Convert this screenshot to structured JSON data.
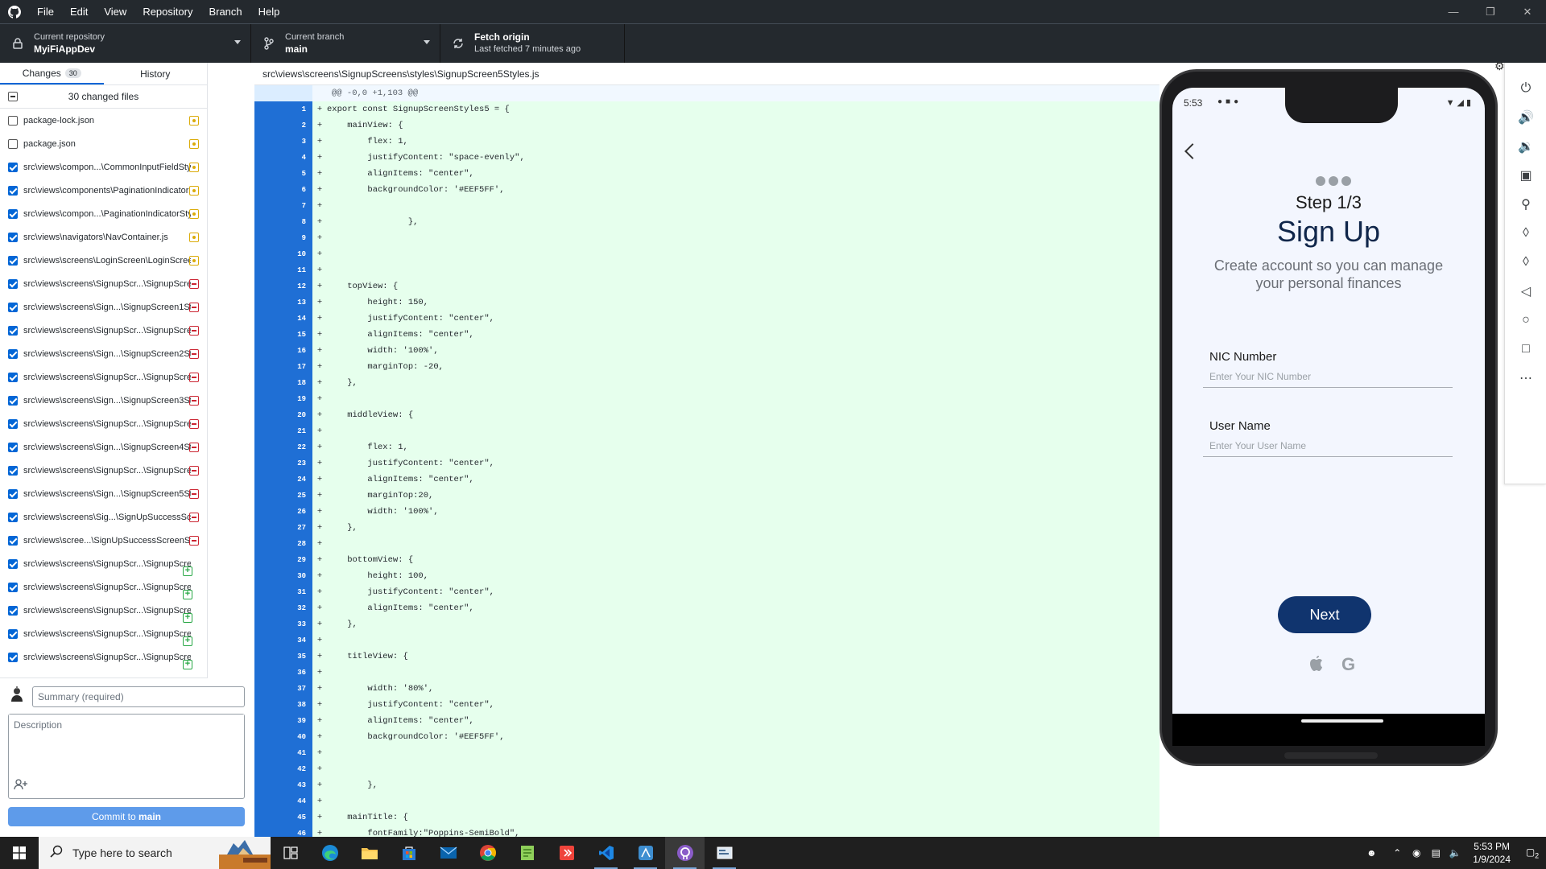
{
  "menu": [
    "File",
    "Edit",
    "View",
    "Repository",
    "Branch",
    "Help"
  ],
  "toolbar": {
    "repo_label": "Current repository",
    "repo_value": "MyiFiAppDev",
    "branch_label": "Current branch",
    "branch_value": "main",
    "fetch_label": "Fetch origin",
    "fetch_sub": "Last fetched 7 minutes ago"
  },
  "tabs": {
    "changes": "Changes",
    "changes_count": "30",
    "history": "History"
  },
  "changed_header": "30 changed files",
  "files": [
    {
      "path": "package-lock.json",
      "checked": false,
      "status": "modified"
    },
    {
      "path": "package.json",
      "checked": false,
      "status": "modified"
    },
    {
      "path": "src\\views\\compon...\\CommonInputFieldStyles.js",
      "checked": true,
      "status": "modified"
    },
    {
      "path": "src\\views\\components\\PaginationIndicator.js",
      "checked": true,
      "status": "modified"
    },
    {
      "path": "src\\views\\compon...\\PaginationIndicatorStyle .js",
      "checked": true,
      "status": "modified"
    },
    {
      "path": "src\\views\\navigators\\NavContainer.js",
      "checked": true,
      "status": "modified"
    },
    {
      "path": "src\\views\\screens\\LoginScreen\\LoginScreen.js",
      "checked": true,
      "status": "modified"
    },
    {
      "path": "src\\views\\screens\\SignupScr...\\SignupScreen1.js",
      "checked": true,
      "status": "deleted"
    },
    {
      "path": "src\\views\\screens\\Sign...\\SignupScreen1Styles.js",
      "checked": true,
      "status": "deleted"
    },
    {
      "path": "src\\views\\screens\\SignupScr...\\SignupScreen2.js",
      "checked": true,
      "status": "deleted"
    },
    {
      "path": "src\\views\\screens\\Sign...\\SignupScreen2Styles.js",
      "checked": true,
      "status": "deleted"
    },
    {
      "path": "src\\views\\screens\\SignupScr...\\SignupScreen3.js",
      "checked": true,
      "status": "deleted"
    },
    {
      "path": "src\\views\\screens\\Sign...\\SignupScreen3Styles.js",
      "checked": true,
      "status": "deleted"
    },
    {
      "path": "src\\views\\screens\\SignupScr...\\SignupScreen4.js",
      "checked": true,
      "status": "deleted"
    },
    {
      "path": "src\\views\\screens\\Sign...\\SignupScreen4Styles.js",
      "checked": true,
      "status": "deleted"
    },
    {
      "path": "src\\views\\screens\\SignupScr...\\SignupScreen5.js",
      "checked": true,
      "status": "deleted"
    },
    {
      "path": "src\\views\\screens\\Sign...\\SignupScreen5Styles.js",
      "checked": true,
      "status": "deleted"
    },
    {
      "path": "src\\views\\screens\\Sig...\\SignUpSuccessScreen.js",
      "checked": true,
      "status": "deleted"
    },
    {
      "path": "src\\views\\scree...\\SignUpSuccessScreenStyles.js",
      "checked": true,
      "status": "deleted"
    },
    {
      "path": "src\\views\\screens\\SignupScr...\\SignupScreen1.js",
      "checked": true,
      "status": "added"
    },
    {
      "path": "src\\views\\screens\\SignupScr...\\SignupScreen2.js",
      "checked": true,
      "status": "added"
    },
    {
      "path": "src\\views\\screens\\SignupScr...\\SignupScreen3.js",
      "checked": true,
      "status": "added"
    },
    {
      "path": "src\\views\\screens\\SignupScr...\\SignupScreen4.js",
      "checked": true,
      "status": "added"
    },
    {
      "path": "src\\views\\screens\\SignupScr...\\SignupScreen5.js",
      "checked": true,
      "status": "added"
    }
  ],
  "commit": {
    "summary_placeholder": "Summary (required)",
    "description_placeholder": "Description",
    "button_prefix": "Commit to ",
    "button_branch": "main"
  },
  "diff": {
    "file_path": "src\\views\\screens\\SignupScreens\\styles\\SignupScreen5Styles.js",
    "hunk": "@@ -0,0 +1,103 @@",
    "lines": [
      "export const SignupScreenStyles5 = {",
      "    mainView: {",
      "        flex: 1,",
      "        justifyContent: \"space-evenly\",",
      "        alignItems: \"center\",",
      "        backgroundColor: '#EEF5FF',",
      "",
      "                },",
      "",
      "",
      "",
      "    topView: {",
      "        height: 150,",
      "        justifyContent: \"center\",",
      "        alignItems: \"center\",",
      "        width: '100%',",
      "        marginTop: -20,",
      "    },",
      "",
      "    middleView: {",
      "",
      "        flex: 1,",
      "        justifyContent: \"center\",",
      "        alignItems: \"center\",",
      "        marginTop:20,",
      "        width: '100%',",
      "    },",
      "",
      "    bottomView: {",
      "        height: 100,",
      "        justifyContent: \"center\",",
      "        alignItems: \"center\",",
      "    },",
      "",
      "    titleView: {",
      "",
      "        width: '80%',",
      "        justifyContent: \"center\",",
      "        alignItems: \"center\",",
      "        backgroundColor: '#EEF5FF',",
      "",
      "",
      "        },",
      "",
      "    mainTitle: {",
      "        fontFamily:\"Poppins-SemiBold\","
    ]
  },
  "phone": {
    "time": "5:53",
    "step": "Step 1/3",
    "title": "Sign Up",
    "subtitle": "Create account so you can manage your personal finances",
    "nic_label": "NIC Number",
    "nic_placeholder": "Enter Your NIC Number",
    "user_label": "User Name",
    "user_placeholder": "Enter Your User Name",
    "next": "Next",
    "google_glyph": "G"
  },
  "taskbar": {
    "search_placeholder": "Type here to search",
    "time": "5:53 PM",
    "date": "1/9/2024",
    "notifications": "2"
  },
  "colors": {
    "accent": "#0366d6",
    "diff_added_bg": "#e6ffed",
    "gutter": "#1f6fd5",
    "phone_button": "#10346e",
    "app_bar": "#24292e"
  }
}
